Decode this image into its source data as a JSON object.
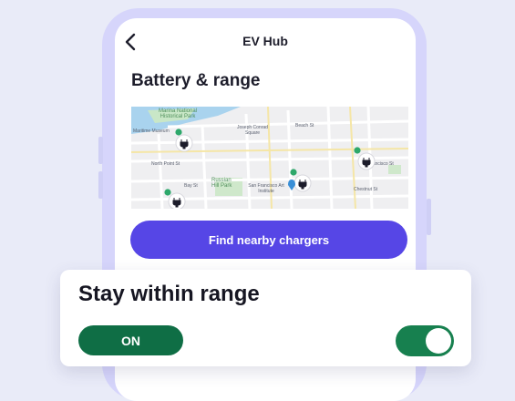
{
  "header": {
    "title": "EV Hub"
  },
  "section": {
    "title": "Battery & range"
  },
  "map": {
    "places": [
      "Marina National Historical Park",
      "Maritime Museum",
      "Joseph Conrad Square",
      "Russian Hill Park",
      "San Francisco Art Institute"
    ],
    "streets": [
      "Bay St",
      "North Point St",
      "Beach St",
      "Chestnut St",
      "Francisco St"
    ],
    "charger_badge": "$"
  },
  "actions": {
    "find_chargers": "Find nearby chargers"
  },
  "range_card": {
    "title": "Stay within range",
    "status": "ON",
    "toggle_on": true
  },
  "colors": {
    "accent": "#5646e6",
    "toggle": "#17804f",
    "status_pill": "#0f6e45"
  }
}
